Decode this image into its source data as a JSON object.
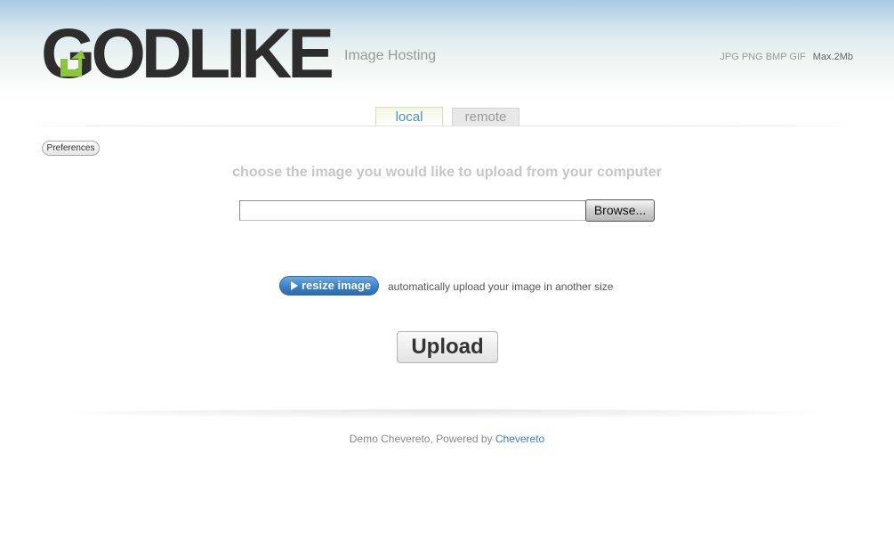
{
  "header": {
    "logo_rest": "ODLIKE",
    "logo_initial": "G",
    "tagline": "Image Hosting",
    "formats": "JPG PNG BMP GIF",
    "max_size": "Max.2Mb"
  },
  "tabs": [
    {
      "label": "local",
      "active": true
    },
    {
      "label": "remote",
      "active": false
    }
  ],
  "preferences_label": "Preferences",
  "upload_form": {
    "instruction": "choose the image you would like to upload from your computer",
    "file_value": "",
    "browse_label": "Browse...",
    "resize_label": "resize image",
    "resize_description": "automatically upload your image in another size",
    "upload_label": "Upload"
  },
  "footer": {
    "text": "Demo Chevereto, Powered by ",
    "link_text": "Chevereto"
  },
  "colors": {
    "accent_blue": "#3c80c6",
    "logo_green": "#8cc63f",
    "logo_dark": "#2d2d2d"
  }
}
